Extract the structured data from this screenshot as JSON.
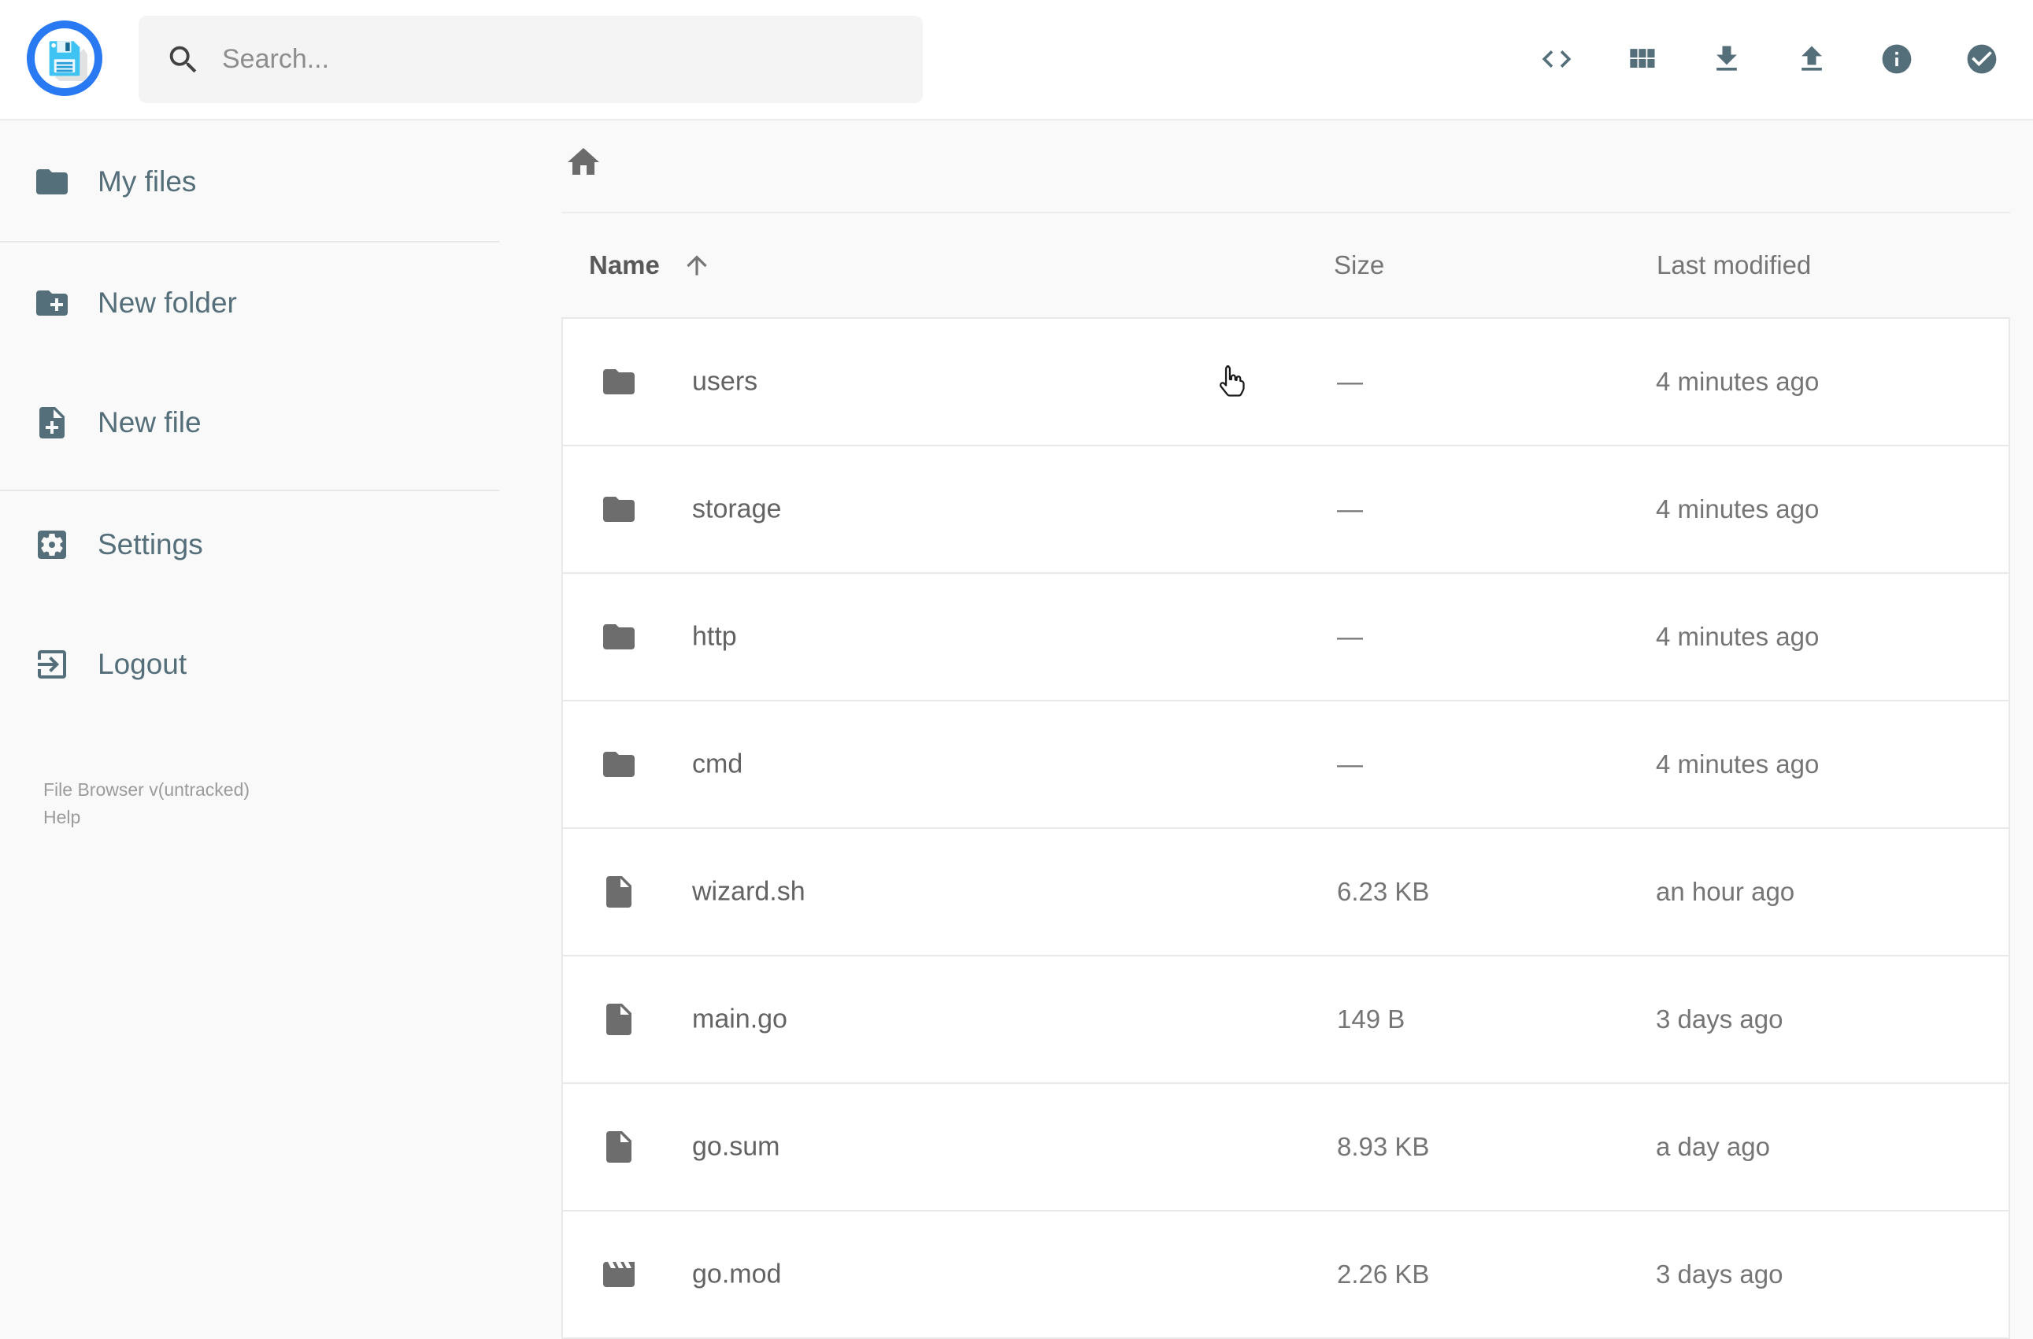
{
  "app_title": "File Browser",
  "colors": {
    "accent": "#546e7a",
    "logo_ring": "#2979f2",
    "list_icon_gray": "#6d6d6d",
    "row_border": "#e9e9e9"
  },
  "header": {
    "search": {
      "placeholder": "Search...",
      "icon": "magnifier-icon",
      "value": ""
    },
    "actions": [
      {
        "icon": "code-icon"
      },
      {
        "icon": "grid-view-icon"
      },
      {
        "icon": "download-icon"
      },
      {
        "icon": "upload-icon"
      },
      {
        "icon": "info-icon"
      },
      {
        "icon": "select-check-icon"
      }
    ]
  },
  "sidebar": {
    "items": [
      {
        "label": "My files",
        "icon": "folder-icon"
      },
      {
        "label": "New folder",
        "icon": "create-new-folder-icon"
      },
      {
        "label": "New file",
        "icon": "new-file-icon"
      },
      {
        "label": "Settings",
        "icon": "settings-icon"
      },
      {
        "label": "Logout",
        "icon": "logout-icon"
      }
    ],
    "footer": {
      "version": "File Browser v(untracked)",
      "help": "Help"
    }
  },
  "breadcrumb": {
    "root_icon": "home-icon"
  },
  "listing": {
    "columns": {
      "name": "Name",
      "size": "Size",
      "modified": "Last modified"
    },
    "sort": {
      "column": "Name",
      "direction": "ascending",
      "icon": "arrow-up-icon"
    },
    "rows": [
      {
        "name": "users",
        "icon": "folder",
        "size": "—",
        "modified": "4 minutes ago"
      },
      {
        "name": "storage",
        "icon": "folder",
        "size": "—",
        "modified": "4 minutes ago"
      },
      {
        "name": "http",
        "icon": "folder",
        "size": "—",
        "modified": "4 minutes ago"
      },
      {
        "name": "cmd",
        "icon": "folder",
        "size": "—",
        "modified": "4 minutes ago"
      },
      {
        "name": "wizard.sh",
        "icon": "file",
        "size": "6.23 KB",
        "modified": "an hour ago"
      },
      {
        "name": "main.go",
        "icon": "file",
        "size": "149 B",
        "modified": "3 days ago"
      },
      {
        "name": "go.sum",
        "icon": "file",
        "size": "8.93 KB",
        "modified": "a day ago"
      },
      {
        "name": "go.mod",
        "icon": "mod",
        "size": "2.26 KB",
        "modified": "3 days ago"
      }
    ]
  }
}
